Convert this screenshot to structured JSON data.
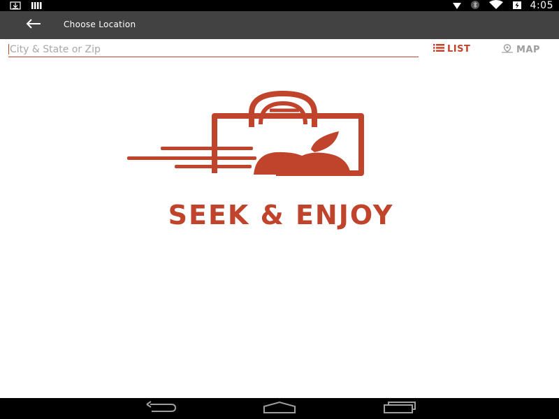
{
  "status_bar": {
    "time": "4:05",
    "icons": [
      "download-icon",
      "bars-icon",
      "location-icon",
      "bluetooth-icon",
      "wifi-icon",
      "battery-charging-icon"
    ]
  },
  "app_bar": {
    "back_icon": "arrow-back-icon",
    "title": "Choose Location"
  },
  "search": {
    "placeholder": "City & State or Zip",
    "value": ""
  },
  "view_toggle": {
    "list_label": "LIST",
    "map_label": "MAP",
    "active": "list",
    "active_color": "#c0432b",
    "inactive_color": "#9e9e9e"
  },
  "brand": {
    "name": "SEEK & ENJOY",
    "color": "#c0432b"
  },
  "nav_bar": {
    "buttons": [
      "back-nav-icon",
      "home-nav-icon",
      "recents-nav-icon"
    ]
  }
}
